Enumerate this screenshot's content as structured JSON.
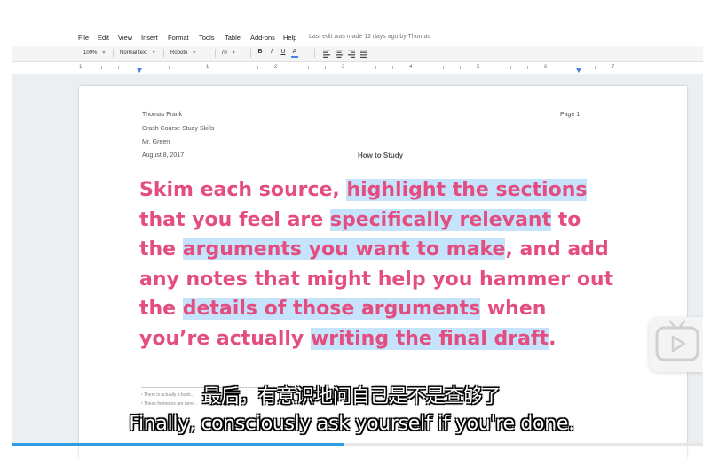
{
  "menu": {
    "items": [
      "File",
      "Edit",
      "View",
      "Insert",
      "Format",
      "Tools",
      "Table",
      "Add-ons",
      "Help"
    ],
    "last_edit": "Last edit was made 12 days ago by Thomas"
  },
  "toolbar": {
    "zoom": "100%",
    "style": "Normal text",
    "font": "Roboto",
    "size": "70",
    "bold": "B",
    "italic": "I",
    "underline": "U",
    "text_color": "A"
  },
  "ruler": {
    "numbers": [
      "1",
      "1",
      "2",
      "3",
      "4",
      "5",
      "6",
      "7"
    ]
  },
  "document": {
    "author": "Thomas Frank",
    "course": "Crash Course Study Skills",
    "teacher": "Mr. Green",
    "date": "August 8, 2017",
    "page": "Page 1",
    "title": "How to Study",
    "body": [
      {
        "text": "Skim each source, ",
        "hl": false
      },
      {
        "text": "highlight the sections",
        "hl": true
      },
      {
        "text": " that you feel are ",
        "hl": false
      },
      {
        "text": "specifically relevant",
        "hl": true
      },
      {
        "text": " to the ",
        "hl": false
      },
      {
        "text": "arguments you want to make",
        "hl": true
      },
      {
        "text": ", and add any notes that might help you hammer out the ",
        "hl": false
      },
      {
        "text": "details of those arguments",
        "hl": true
      },
      {
        "text": " when you’re actually ",
        "hl": false
      },
      {
        "text": "writing the final draft",
        "hl": true
      },
      {
        "text": ".",
        "hl": false
      }
    ],
    "footnotes": [
      "¹ There is actually a book...",
      "² These footnotes are here..."
    ]
  },
  "subtitles": {
    "zh": "最后，有意识地问自己是不是查够了",
    "en": "Finally, consciously ask yourself if you're done."
  },
  "video": {
    "progress": 0.47
  },
  "colors": {
    "body_text": "#e34d80",
    "highlight": "#c5e3fb",
    "progress": "#2f9be3"
  }
}
